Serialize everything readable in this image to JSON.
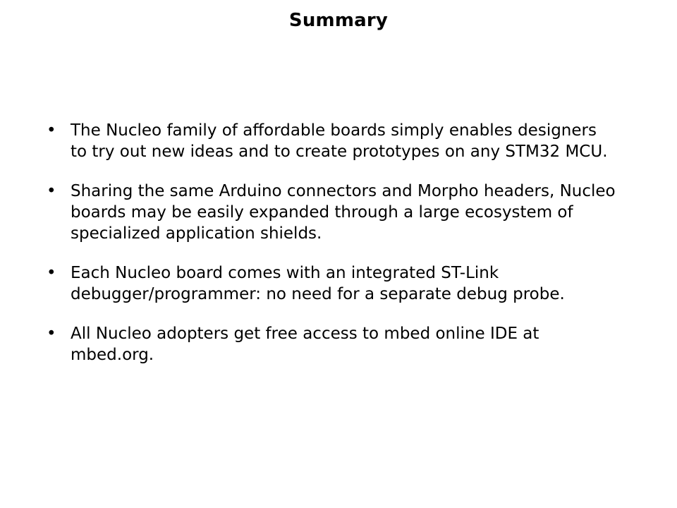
{
  "slide": {
    "title": "Summary",
    "background_color": "#ffffff",
    "text_color": "#000000",
    "bullet_marker": "•",
    "bullets": [
      {
        "text": "The Nucleo family of affordable boards simply enables designers\nto try out new ideas and to create prototypes on any STM32 MCU."
      },
      {
        "text": "Sharing the same Arduino connectors and Morpho headers, Nucleo\nboards may be easily expanded through a large ecosystem of\nspecialized application shields."
      },
      {
        "text": "Each Nucleo board comes with an integrated ST-Link\ndebugger/programmer: no need for a separate debug probe."
      },
      {
        "text": "All Nucleo adopters get free access to mbed online IDE at\nmbed.org."
      }
    ]
  }
}
